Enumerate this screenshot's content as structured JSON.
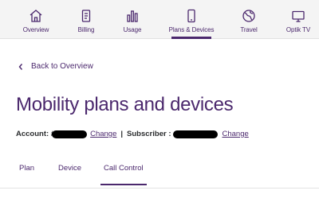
{
  "nav": {
    "items": [
      {
        "label": "Overview",
        "icon": "home-icon"
      },
      {
        "label": "Billing",
        "icon": "bill-icon"
      },
      {
        "label": "Usage",
        "icon": "bar-chart-icon"
      },
      {
        "label": "Plans & Devices",
        "icon": "phone-icon",
        "active": true
      },
      {
        "label": "Travel",
        "icon": "globe-icon"
      },
      {
        "label": "Optik TV",
        "icon": "tv-icon"
      }
    ]
  },
  "back_link": "Back to Overview",
  "page_title": "Mobility plans and devices",
  "account": {
    "account_label": "Account: #",
    "change_label": "Change",
    "separator": "|",
    "subscriber_label": "Subscriber :",
    "subscriber_change_label": "Change"
  },
  "tabs": [
    {
      "label": "Plan"
    },
    {
      "label": "Device"
    },
    {
      "label": "Call Control",
      "active": true
    }
  ],
  "colors": {
    "brand": "#4b286d",
    "nav_bg": "#f4f4f4"
  }
}
